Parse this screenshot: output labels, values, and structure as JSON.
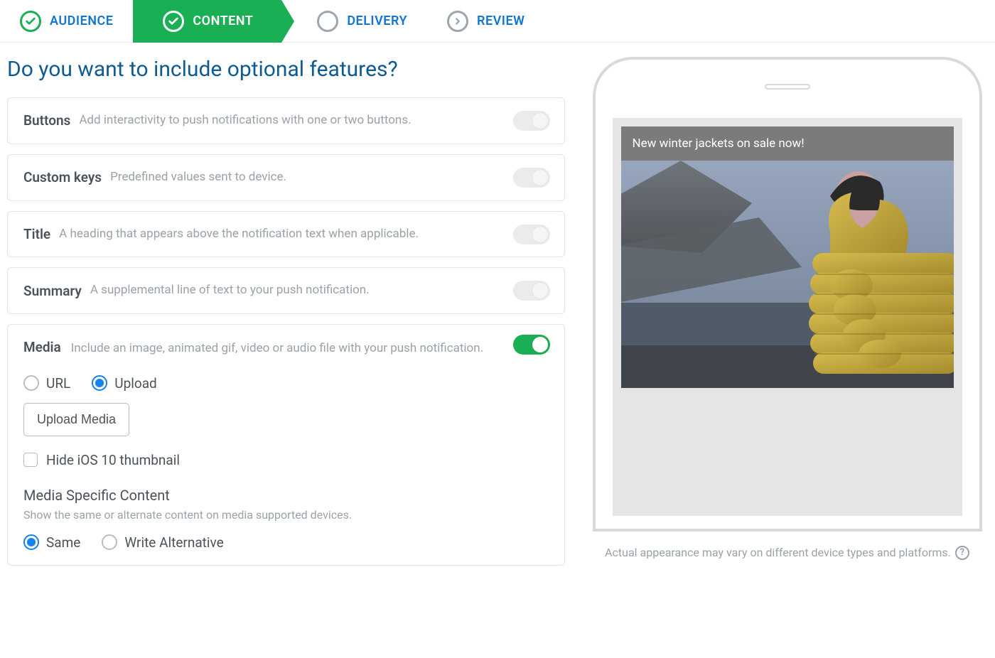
{
  "wizard": {
    "steps": [
      {
        "label": "AUDIENCE"
      },
      {
        "label": "CONTENT"
      },
      {
        "label": "DELIVERY"
      },
      {
        "label": "REVIEW"
      }
    ]
  },
  "page": {
    "title": "Do you want to include optional features?"
  },
  "features": {
    "buttons": {
      "title": "Buttons",
      "desc": "Add interactivity to push notifications with one or two buttons."
    },
    "custom_keys": {
      "title": "Custom keys",
      "desc": "Predefined values sent to device."
    },
    "title_feat": {
      "title": "Title",
      "desc": "A heading that appears above the notification text when applicable."
    },
    "summary": {
      "title": "Summary",
      "desc": "A supplemental line of text to your push notification."
    },
    "media": {
      "title": "Media",
      "desc": "Include an image, animated gif, video or audio file with your push notification.",
      "source_options": {
        "url": "URL",
        "upload": "Upload"
      },
      "upload_button": "Upload Media",
      "hide_thumb": "Hide iOS 10 thumbnail",
      "specific": {
        "heading": "Media Specific Content",
        "desc": "Show the same or alternate content on media supported devices.",
        "same": "Same",
        "alt": "Write Alternative"
      }
    }
  },
  "preview": {
    "notification_text": "New winter jackets on sale now!",
    "hint": "Actual appearance may vary on different device types and platforms."
  }
}
